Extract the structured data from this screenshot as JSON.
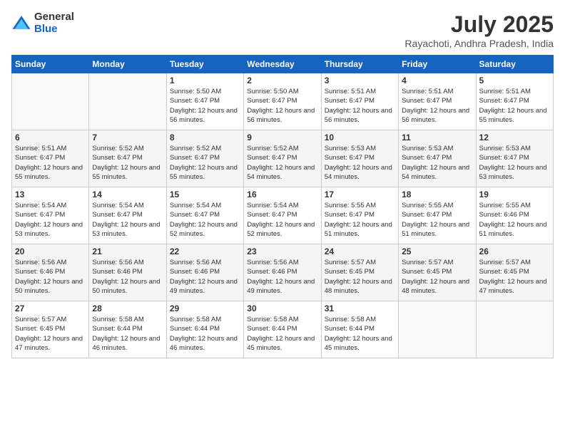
{
  "logo": {
    "general": "General",
    "blue": "Blue"
  },
  "title": "July 2025",
  "subtitle": "Rayachoti, Andhra Pradesh, India",
  "headers": [
    "Sunday",
    "Monday",
    "Tuesday",
    "Wednesday",
    "Thursday",
    "Friday",
    "Saturday"
  ],
  "weeks": [
    [
      {
        "day": "",
        "info": ""
      },
      {
        "day": "",
        "info": ""
      },
      {
        "day": "1",
        "info": "Sunrise: 5:50 AM\nSunset: 6:47 PM\nDaylight: 12 hours and 56 minutes."
      },
      {
        "day": "2",
        "info": "Sunrise: 5:50 AM\nSunset: 6:47 PM\nDaylight: 12 hours and 56 minutes."
      },
      {
        "day": "3",
        "info": "Sunrise: 5:51 AM\nSunset: 6:47 PM\nDaylight: 12 hours and 56 minutes."
      },
      {
        "day": "4",
        "info": "Sunrise: 5:51 AM\nSunset: 6:47 PM\nDaylight: 12 hours and 56 minutes."
      },
      {
        "day": "5",
        "info": "Sunrise: 5:51 AM\nSunset: 6:47 PM\nDaylight: 12 hours and 55 minutes."
      }
    ],
    [
      {
        "day": "6",
        "info": "Sunrise: 5:51 AM\nSunset: 6:47 PM\nDaylight: 12 hours and 55 minutes."
      },
      {
        "day": "7",
        "info": "Sunrise: 5:52 AM\nSunset: 6:47 PM\nDaylight: 12 hours and 55 minutes."
      },
      {
        "day": "8",
        "info": "Sunrise: 5:52 AM\nSunset: 6:47 PM\nDaylight: 12 hours and 55 minutes."
      },
      {
        "day": "9",
        "info": "Sunrise: 5:52 AM\nSunset: 6:47 PM\nDaylight: 12 hours and 54 minutes."
      },
      {
        "day": "10",
        "info": "Sunrise: 5:53 AM\nSunset: 6:47 PM\nDaylight: 12 hours and 54 minutes."
      },
      {
        "day": "11",
        "info": "Sunrise: 5:53 AM\nSunset: 6:47 PM\nDaylight: 12 hours and 54 minutes."
      },
      {
        "day": "12",
        "info": "Sunrise: 5:53 AM\nSunset: 6:47 PM\nDaylight: 12 hours and 53 minutes."
      }
    ],
    [
      {
        "day": "13",
        "info": "Sunrise: 5:54 AM\nSunset: 6:47 PM\nDaylight: 12 hours and 53 minutes."
      },
      {
        "day": "14",
        "info": "Sunrise: 5:54 AM\nSunset: 6:47 PM\nDaylight: 12 hours and 53 minutes."
      },
      {
        "day": "15",
        "info": "Sunrise: 5:54 AM\nSunset: 6:47 PM\nDaylight: 12 hours and 52 minutes."
      },
      {
        "day": "16",
        "info": "Sunrise: 5:54 AM\nSunset: 6:47 PM\nDaylight: 12 hours and 52 minutes."
      },
      {
        "day": "17",
        "info": "Sunrise: 5:55 AM\nSunset: 6:47 PM\nDaylight: 12 hours and 51 minutes."
      },
      {
        "day": "18",
        "info": "Sunrise: 5:55 AM\nSunset: 6:47 PM\nDaylight: 12 hours and 51 minutes."
      },
      {
        "day": "19",
        "info": "Sunrise: 5:55 AM\nSunset: 6:46 PM\nDaylight: 12 hours and 51 minutes."
      }
    ],
    [
      {
        "day": "20",
        "info": "Sunrise: 5:56 AM\nSunset: 6:46 PM\nDaylight: 12 hours and 50 minutes."
      },
      {
        "day": "21",
        "info": "Sunrise: 5:56 AM\nSunset: 6:46 PM\nDaylight: 12 hours and 50 minutes."
      },
      {
        "day": "22",
        "info": "Sunrise: 5:56 AM\nSunset: 6:46 PM\nDaylight: 12 hours and 49 minutes."
      },
      {
        "day": "23",
        "info": "Sunrise: 5:56 AM\nSunset: 6:46 PM\nDaylight: 12 hours and 49 minutes."
      },
      {
        "day": "24",
        "info": "Sunrise: 5:57 AM\nSunset: 6:45 PM\nDaylight: 12 hours and 48 minutes."
      },
      {
        "day": "25",
        "info": "Sunrise: 5:57 AM\nSunset: 6:45 PM\nDaylight: 12 hours and 48 minutes."
      },
      {
        "day": "26",
        "info": "Sunrise: 5:57 AM\nSunset: 6:45 PM\nDaylight: 12 hours and 47 minutes."
      }
    ],
    [
      {
        "day": "27",
        "info": "Sunrise: 5:57 AM\nSunset: 6:45 PM\nDaylight: 12 hours and 47 minutes."
      },
      {
        "day": "28",
        "info": "Sunrise: 5:58 AM\nSunset: 6:44 PM\nDaylight: 12 hours and 46 minutes."
      },
      {
        "day": "29",
        "info": "Sunrise: 5:58 AM\nSunset: 6:44 PM\nDaylight: 12 hours and 46 minutes."
      },
      {
        "day": "30",
        "info": "Sunrise: 5:58 AM\nSunset: 6:44 PM\nDaylight: 12 hours and 45 minutes."
      },
      {
        "day": "31",
        "info": "Sunrise: 5:58 AM\nSunset: 6:44 PM\nDaylight: 12 hours and 45 minutes."
      },
      {
        "day": "",
        "info": ""
      },
      {
        "day": "",
        "info": ""
      }
    ]
  ]
}
